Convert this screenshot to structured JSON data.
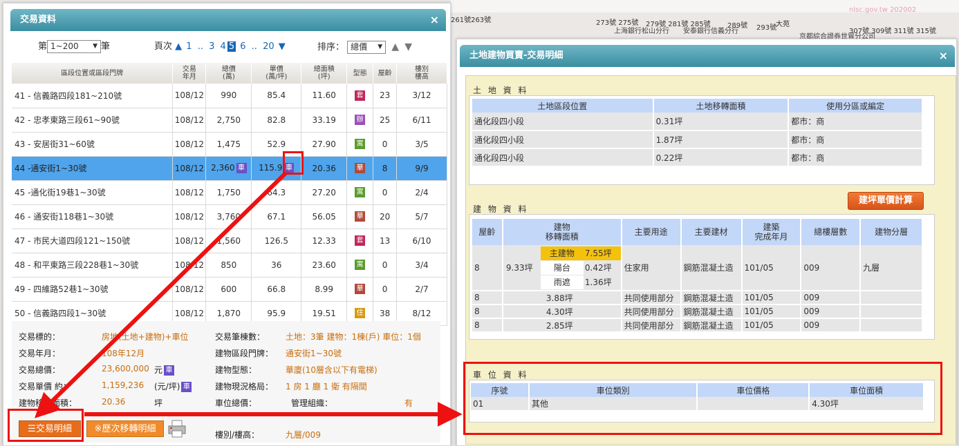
{
  "map": {
    "labels": [
      "261號263號",
      "273號 275號",
      "279號 281號 285號",
      "289號",
      "293號",
      "大苑",
      "307號 309號 311號 315號"
    ],
    "banks": [
      "上海銀行松山分行",
      "安泰銀行信義分行",
      "京都綜合證券世貿分公司"
    ],
    "watermark": "nlsc.gov.tw 202002"
  },
  "left_panel": {
    "title": "交易資料",
    "close": "×",
    "controls": {
      "page_prefix": "第",
      "range_value": "1~200",
      "page_suffix": "筆",
      "pages_label": "頁次",
      "pages": [
        "1",
        "..",
        "3",
        "4",
        "5",
        "6",
        "..",
        "20"
      ],
      "current_page": "5",
      "sort_label": "排序：",
      "sort_value": "總價"
    },
    "columns": [
      "區段位置或區段門牌",
      "交易\n年月",
      "總價\n(萬)",
      "單價\n(萬/坪)",
      "總面積\n(坪)",
      "型態",
      "屋齡",
      "樓別\n樓高"
    ],
    "rows": [
      {
        "loc": "41 - 信義路四段181~210號",
        "ym": "108/12",
        "total": "990",
        "unit": "85.4",
        "area": "11.60",
        "type": "套",
        "type_color": "#c0265b",
        "age": "23",
        "floor": "3/12"
      },
      {
        "loc": "42 - 忠孝東路三段61~90號",
        "ym": "108/12",
        "total": "2,750",
        "unit": "82.8",
        "area": "33.19",
        "type": "辦",
        "type_color": "#9b4fb8",
        "age": "25",
        "floor": "6/11"
      },
      {
        "loc": "43 - 安居街31~60號",
        "ym": "108/12",
        "total": "1,475",
        "unit": "52.9",
        "area": "27.90",
        "type": "寓",
        "type_color": "#5a9b2e",
        "age": "0",
        "floor": "3/5"
      },
      {
        "loc": "44 -通安街1~30號",
        "ym": "108/12",
        "total": "2,360",
        "total_tag": "車",
        "unit": "115.9",
        "unit_tag": "車",
        "area": "20.36",
        "type": "華",
        "type_color": "#b04a3a",
        "age": "8",
        "floor": "9/9"
      },
      {
        "loc": "45 -通化街19巷1~30號",
        "ym": "108/12",
        "total": "1,750",
        "unit": "64.3",
        "area": "27.20",
        "type": "寓",
        "type_color": "#5a9b2e",
        "age": "0",
        "floor": "2/4"
      },
      {
        "loc": "46 - 通安街118巷1~30號",
        "ym": "108/12",
        "total": "3,760",
        "unit": "67.1",
        "area": "56.05",
        "type": "華",
        "type_color": "#b04a3a",
        "age": "20",
        "floor": "5/7"
      },
      {
        "loc": "47 - 市民大道四段121~150號",
        "ym": "108/12",
        "total": "1,560",
        "unit": "126.5",
        "area": "12.33",
        "type": "套",
        "type_color": "#c0265b",
        "age": "13",
        "floor": "6/10"
      },
      {
        "loc": "48 - 和平東路三段228巷1~30號",
        "ym": "108/12",
        "total": "850",
        "unit": "36",
        "area": "23.60",
        "type": "寓",
        "type_color": "#5a9b2e",
        "age": "0",
        "floor": "3/4"
      },
      {
        "loc": "49 - 四維路52巷1~30號",
        "ym": "108/12",
        "total": "600",
        "unit": "66.8",
        "area": "8.99",
        "type": "華",
        "type_color": "#b04a3a",
        "age": "0",
        "floor": "2/7"
      },
      {
        "loc": "50 - 信義路四段1~30號",
        "ym": "108/12",
        "total": "1,870",
        "unit": "95.9",
        "area": "19.51",
        "type": "住",
        "type_color": "#d69a14",
        "age": "38",
        "floor": "8/12"
      }
    ],
    "summary": {
      "target_label": "交易標的：",
      "target_value": "房地(土地+建物)+車位",
      "count_label": "交易筆棟數：",
      "count_value": "土地：3筆 建物：1棟(戶) 車位：1個",
      "ym_label": "交易年月：",
      "ym_value": "108年12月",
      "addr_label": "建物區段門牌：",
      "addr_value": "通安街1~30號",
      "total_label": "交易總價：",
      "total_value": "23,600,000",
      "total_unit": "元",
      "btype_label": "建物型態：",
      "btype_value": "華廈(10層含以下有電梯)",
      "unit_label": "交易單價 約：",
      "unit_value": "1,159,236",
      "unit_unit": "(元/坪)",
      "layout_label": "建物現況格局：",
      "layout_value": "1 房 1 廳 1 衛 有隔間",
      "area_label": "建物移轉面積：",
      "area_value": "20.36",
      "area_unit": "坪",
      "park_label": "車位總價：",
      "mgmt_label": "管理組織：",
      "mgmt_value": "有",
      "floor_label": "樓別/樓高：",
      "floor_value": "九層/009",
      "che_tag": "車"
    },
    "buttons": {
      "detail": "交易明細",
      "history": "※歷次移轉明細"
    }
  },
  "right_panel": {
    "title": "土地建物買賣-交易明細",
    "close": "×",
    "land": {
      "title": "土 地 資 料",
      "headers": [
        "土地區段位置",
        "土地移轉面積",
        "使用分區或編定"
      ],
      "rows": [
        [
          "通化段四小段",
          "0.31坪",
          "都市：商"
        ],
        [
          "通化段四小段",
          "1.87坪",
          "都市：商"
        ],
        [
          "通化段四小段",
          "0.22坪",
          "都市：商"
        ]
      ]
    },
    "calc_button": "建坪單價計算",
    "building": {
      "title": "建 物 資 料",
      "headers": [
        "屋齡",
        "建物\n移轉面積",
        "主要用途",
        "主要建材",
        "建築\n完成年月",
        "總樓層數",
        "建物分層"
      ],
      "main": {
        "age": "8",
        "area": "9.33坪",
        "use": "住家用",
        "material": "鋼筋混凝土造",
        "completed": "101/05",
        "floors": "009",
        "layer": "九層",
        "subs": [
          {
            "name": "主建物",
            "value": "7.55坪"
          },
          {
            "name": "陽台",
            "value": "0.42坪"
          },
          {
            "name": "雨遮",
            "value": "1.36坪"
          }
        ]
      },
      "extra_rows": [
        {
          "age": "8",
          "area": "3.88坪",
          "use": "共同使用部分",
          "material": "鋼筋混凝土造",
          "completed": "101/05",
          "floors": "009"
        },
        {
          "age": "8",
          "area": "4.30坪",
          "use": "共同使用部分",
          "material": "鋼筋混凝土造",
          "completed": "101/05",
          "floors": "009"
        },
        {
          "age": "8",
          "area": "2.85坪",
          "use": "共同使用部分",
          "material": "鋼筋混凝土造",
          "completed": "101/05",
          "floors": "009"
        }
      ]
    },
    "parking": {
      "title": "車 位 資 料",
      "headers": [
        "序號",
        "車位類別",
        "車位價格",
        "車位面積"
      ],
      "rows": [
        [
          "01",
          "其他",
          "",
          "4.30坪"
        ]
      ]
    }
  },
  "annotation_color": "#ee1111"
}
